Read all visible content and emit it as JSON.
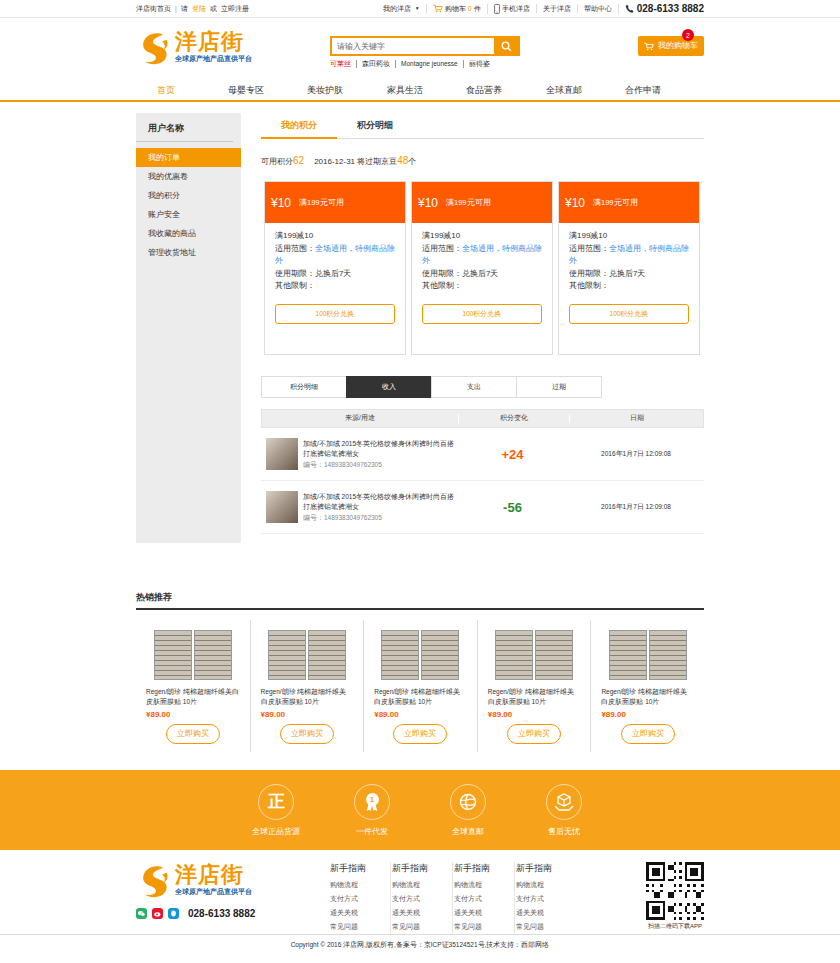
{
  "top_bar": {
    "left": {
      "home": "洋店街首页",
      "divider": "|",
      "please": "请",
      "login": "登陆",
      "or": "或",
      "register": "立即注册"
    },
    "my_store": {
      "label": "我的洋店",
      "arrow": "▼"
    },
    "cart": {
      "label": "购物车",
      "count": "0",
      "unit": "件"
    },
    "links": [
      "手机洋店",
      "关于洋店",
      "帮助中心"
    ],
    "phone": "028-6133 8882"
  },
  "header": {
    "logo": {
      "name": "洋店街",
      "slogan": "全球原产地产品直供平台"
    },
    "search": {
      "placeholder": "请输入关键字"
    },
    "hot_words": [
      {
        "label": "可莱丝",
        "highlighted": true
      },
      {
        "label": "森田药妆",
        "highlighted": false
      },
      {
        "label": "Montagne jeunesse",
        "highlighted": false
      },
      {
        "label": "丽得姿",
        "highlighted": false
      }
    ],
    "cart_button": {
      "label": "我的购物车",
      "badge": "2"
    }
  },
  "nav": [
    {
      "label": "首页",
      "selected": true
    },
    {
      "label": "母婴专区",
      "selected": false
    },
    {
      "label": "美妆护肤",
      "selected": false
    },
    {
      "label": "家具生活",
      "selected": false
    },
    {
      "label": "食品营养",
      "selected": false
    },
    {
      "label": "全球直邮",
      "selected": false
    },
    {
      "label": "合作申请",
      "selected": false
    }
  ],
  "sidebar": {
    "title": "用户名称",
    "items": [
      {
        "label": "我的订单",
        "selected": true
      },
      {
        "label": "我的优惠卷",
        "selected": false
      },
      {
        "label": "我的积分",
        "selected": false
      },
      {
        "label": "账户安全",
        "selected": false
      },
      {
        "label": "我收藏的商品",
        "selected": false
      },
      {
        "label": "管理收货地址",
        "selected": false
      }
    ]
  },
  "content_tabs": [
    {
      "label": "我的积分",
      "selected": true
    },
    {
      "label": "积分明细",
      "selected": false
    }
  ],
  "points_summary": {
    "label": "可用积分",
    "points": "62",
    "expire_text": "2016-12-31 将过期京豆",
    "expire_amount": "48",
    "unit": "个"
  },
  "coupons": [
    {
      "amount": "¥10",
      "condition": "满199元可用",
      "title": "满199减10",
      "scope_label": "适用范围：",
      "scope": "全场通用，特例商品除外",
      "period": "使用期限：兑换后7天",
      "other": "其他限制：",
      "button": "100积分兑换"
    },
    {
      "amount": "¥10",
      "condition": "满199元可用",
      "title": "满199减10",
      "scope_label": "适用范围：",
      "scope": "全场通用，特例商品除外",
      "period": "使用期限：兑换后7天",
      "other": "其他限制：",
      "button": "100积分兑换"
    },
    {
      "amount": "¥10",
      "condition": "满199元可用",
      "title": "满199减10",
      "scope_label": "适用范围：",
      "scope": "全场通用，特例商品除外",
      "period": "使用期限：兑换后7天",
      "other": "其他限制：",
      "button": "100积分兑换"
    }
  ],
  "detail_tabs": [
    {
      "label": "积分明细",
      "selected": false
    },
    {
      "label": "收入",
      "selected": true
    },
    {
      "label": "支出",
      "selected": false
    },
    {
      "label": "过期",
      "selected": false
    }
  ],
  "table": {
    "columns": [
      "来源/用途",
      "积分变化",
      "日期"
    ],
    "rows": [
      {
        "title": "加绒/不加绒 2015冬英伦格纹修身休闲裤时尚百搭打底裤铅笔裤潮女",
        "serial": "编号：1489383049762305",
        "change": "+24",
        "color": "#ff5a00",
        "date": "2016年1月7日 12:09:08"
      },
      {
        "title": "加绒/不加绒 2015冬英伦格纹修身休闲裤时尚百搭打底裤铅笔裤潮女",
        "serial": "编号：1489383049762305",
        "change": "-56",
        "color": "#2e8b2e",
        "date": "2016年1月7日 12:09:08"
      }
    ]
  },
  "hot": {
    "title": "热销推荐",
    "products": [
      {
        "name": "Regen/朗珍 纯棉超细纤维美白皮肤面膜贴 10片",
        "price": "¥89.00",
        "button": "立即购买"
      },
      {
        "name": "Regen/朗珍 纯棉超细纤维美白皮肤面膜贴 10片",
        "price": "¥89.00",
        "button": "立即购买"
      },
      {
        "name": "Regen/朗珍 纯棉超细纤维美白皮肤面膜贴 10片",
        "price": "¥89.00",
        "button": "立即购买"
      },
      {
        "name": "Regen/朗珍 纯棉超细纤维美白皮肤面膜贴 10片",
        "price": "¥89.00",
        "button": "立即购买"
      },
      {
        "name": "Regen/朗珍 纯棉超细纤维美白皮肤面膜贴 10片",
        "price": "¥89.00",
        "button": "立即购买"
      }
    ]
  },
  "features": [
    {
      "label": "全球正品货源",
      "kind": "glyph",
      "icon_text": "正"
    },
    {
      "label": "一件代发",
      "kind": "badge",
      "icon_text": "1"
    },
    {
      "label": "全球直邮",
      "kind": "globe"
    },
    {
      "label": "售后无忧",
      "kind": "box"
    }
  ],
  "footer": {
    "logo": {
      "name": "洋店街",
      "slogan": "全球原产地产品直供平台"
    },
    "phone": "028-6133 8882",
    "columns": [
      {
        "title": "新手指南",
        "links": [
          "购物流程",
          "支付方式",
          "通关关税",
          "常见问题"
        ]
      },
      {
        "title": "新手指南",
        "links": [
          "购物流程",
          "支付方式",
          "通关关税",
          "常见问题"
        ]
      },
      {
        "title": "新手指南",
        "links": [
          "购物流程",
          "支付方式",
          "通关关税",
          "常见问题"
        ]
      },
      {
        "title": "新手指南",
        "links": [
          "购物流程",
          "支付方式",
          "通关关税",
          "常见问题"
        ]
      }
    ],
    "qr_caption": "扫描二维码下载APP",
    "copyright": "Copyright © 2016 洋店网,版权所有,备案号：京ICP证35124521号,技术支持：西部网络"
  }
}
